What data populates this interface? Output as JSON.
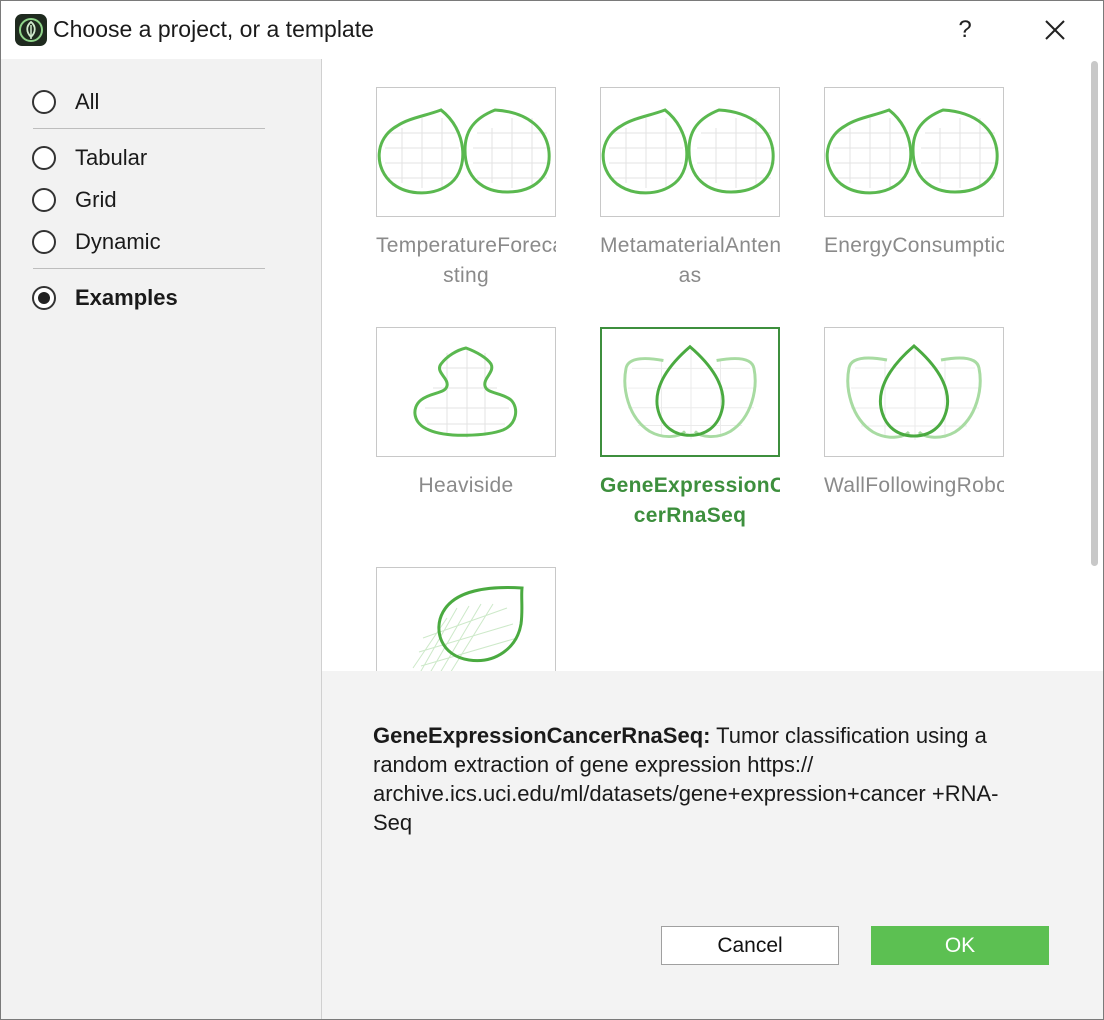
{
  "window": {
    "title": "Choose a project, or a template",
    "help_label": "?"
  },
  "sidebar": {
    "options": [
      {
        "label": "All",
        "checked": false
      },
      {
        "label": "Tabular",
        "checked": false
      },
      {
        "label": "Grid",
        "checked": false
      },
      {
        "label": "Dynamic",
        "checked": false
      },
      {
        "label": "Examples",
        "checked": true
      }
    ]
  },
  "gallery": {
    "tiles": [
      {
        "line1": "TemperatureForeca",
        "line2": "sting",
        "selected": false,
        "thumbnail": "twin-leaves-icon"
      },
      {
        "line1": "MetamaterialAntenn",
        "line2": "as",
        "selected": false,
        "thumbnail": "twin-leaves-icon"
      },
      {
        "line1": "EnergyConsumption",
        "line2": "",
        "selected": false,
        "thumbnail": "twin-leaves-icon"
      },
      {
        "line1": "Heaviside",
        "line2": "",
        "selected": false,
        "thumbnail": "vase-shape-icon"
      },
      {
        "line1": "GeneExpressionCa",
        "line2": "cerRnaSeq",
        "selected": true,
        "thumbnail": "triple-leaves-icon"
      },
      {
        "line1": "WallFollowingRobot",
        "line2": "",
        "selected": false,
        "thumbnail": "triple-leaves-icon"
      },
      {
        "line1": "",
        "line2": "",
        "selected": false,
        "thumbnail": "tilted-leaf-icon"
      }
    ]
  },
  "description": {
    "name": "GeneExpressionCancerRnaSeq:",
    "text": " Tumor classification using a random extraction of gene expression https:// archive.ics.uci.edu/ml/datasets/gene+expression+cancer +RNA-Seq"
  },
  "buttons": {
    "cancel": "Cancel",
    "ok": "OK"
  },
  "colors": {
    "accent": "#5cc052",
    "selected_text": "#3d8f3d",
    "panel_bg": "#f2f2f2"
  }
}
